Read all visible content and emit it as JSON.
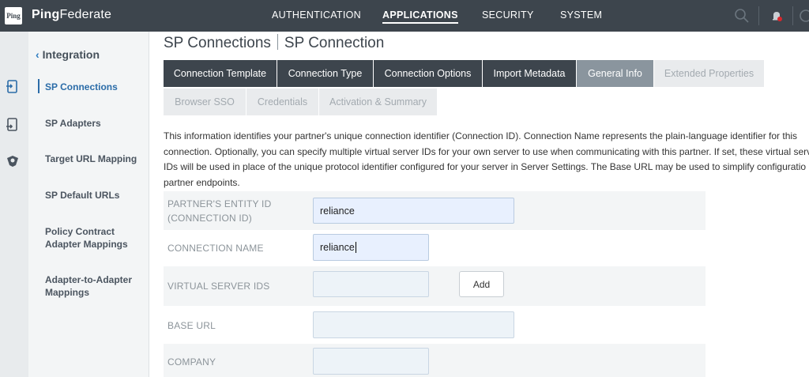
{
  "header": {
    "logo_text": "Ping",
    "brand_bold": "Ping",
    "brand_rest": "Federate",
    "nav": [
      {
        "label": "AUTHENTICATION",
        "active": false
      },
      {
        "label": "APPLICATIONS",
        "active": true
      },
      {
        "label": "SECURITY",
        "active": false
      },
      {
        "label": "SYSTEM",
        "active": false
      }
    ],
    "icons": [
      "search-icon",
      "notifications-icon",
      "help-icon"
    ]
  },
  "rail": {
    "icons": [
      "sp-connections-icon",
      "sp-adapters-icon",
      "target-url-mapping-icon"
    ]
  },
  "sidebar": {
    "back_label": "Integration",
    "items": [
      {
        "label": "SP Connections",
        "active": true
      },
      {
        "label": "SP Adapters",
        "active": false
      },
      {
        "label": "Target URL Mapping",
        "active": false
      },
      {
        "label": "SP Default URLs",
        "active": false
      },
      {
        "label": "Policy Contract\nAdapter Mappings",
        "active": false
      },
      {
        "label": "Adapter-to-Adapter\nMappings",
        "active": false
      }
    ]
  },
  "main": {
    "title_part1": "SP Connections",
    "title_part2": "SP Connection",
    "tabs": [
      {
        "label": "Connection Template",
        "state": "done"
      },
      {
        "label": "Connection Type",
        "state": "done"
      },
      {
        "label": "Connection Options",
        "state": "done"
      },
      {
        "label": "Import Metadata",
        "state": "done"
      },
      {
        "label": "General Info",
        "state": "current"
      },
      {
        "label": "Extended Properties",
        "state": "future"
      },
      {
        "label": "Browser SSO",
        "state": "future"
      },
      {
        "label": "Credentials",
        "state": "future"
      },
      {
        "label": "Activation & Summary",
        "state": "future"
      }
    ],
    "intro_lines": [
      "This information identifies your partner's unique connection identifier (Connection ID). Connection Name represents the plain-language identifier for this",
      "connection. Optionally, you can specify multiple virtual server IDs for your own server to use when communicating with this partner. If set, these virtual serv",
      "IDs will be used in place of the unique protocol identifier configured for your server in Server Settings. The Base URL may be used to simplify configuratio",
      "partner endpoints."
    ],
    "form": {
      "entity_id_label_line1": "PARTNER'S ENTITY ID",
      "entity_id_label_line2": "(CONNECTION ID)",
      "entity_id_value": "reliance",
      "connection_name_label": "CONNECTION NAME",
      "connection_name_value": "reliance",
      "virtual_server_ids_label": "VIRTUAL SERVER IDS",
      "virtual_server_ids_value": "",
      "add_button_label": "Add",
      "base_url_label": "BASE URL",
      "base_url_value": "",
      "company_label": "COMPANY",
      "company_value": ""
    }
  },
  "colors": {
    "topbar": "#3d454d",
    "tab_done": "#3d454d",
    "tab_current": "#8a959e",
    "tab_future": "#e9ebed",
    "accent": "#2b6ca8"
  }
}
